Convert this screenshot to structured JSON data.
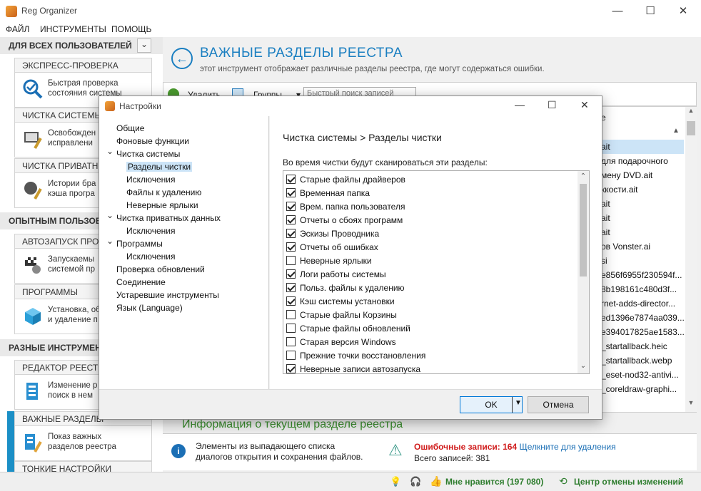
{
  "window": {
    "title": "Reg Organizer",
    "minimize": "—",
    "maximize": "☐",
    "close": "✕"
  },
  "menu": [
    "ФАЙЛ",
    "ИНСТРУМЕНТЫ",
    "ПОМОЩЬ"
  ],
  "sidebar": {
    "for_all_users": "ДЛЯ ВСЕХ ПОЛЬЗОВАТЕЛЕЙ",
    "experienced": "ОПЫТНЫМ ПОЛЬЗОВ",
    "various_tools": "РАЗНЫЕ ИНСТРУМЕНТ",
    "cards": [
      {
        "title": "ЭКСПРЕСС-ПРОВЕРКА",
        "l1": "Быстрая проверка",
        "l2": "состояния системы"
      },
      {
        "title": "ЧИСТКА СИСТЕМЫ",
        "l1": "Освобожден",
        "l2": "исправлени"
      },
      {
        "title": "ЧИСТКА ПРИВАТНЫ",
        "l1": "Истории бра",
        "l2": "кэша програ"
      },
      {
        "title": "АВТОЗАПУСК ПРОГ",
        "l1": "Запускаемы",
        "l2": "системой пр"
      },
      {
        "title": "ПРОГРАММЫ",
        "l1": "Установка, об",
        "l2": "и удаление п"
      },
      {
        "title": "РЕДАКТОР РЕЕСТРА",
        "l1": "Изменение р",
        "l2": "поиск в нем"
      },
      {
        "title": "ВАЖНЫЕ РАЗДЕЛЫ",
        "l1": "Показ важных",
        "l2": "разделов реестра"
      },
      {
        "title": "ТОНКИЕ НАСТРОЙКИ"
      }
    ]
  },
  "main": {
    "title": "ВАЖНЫЕ РАЗДЕЛЫ РЕЕСТРА",
    "subtitle": "этот инструмент отображает различные разделы реестра, где могут содержаться ошибки.",
    "toolbar": {
      "delete": "Удалить",
      "groups": "Группы",
      "search_placeholder": "Быстрый поиск записей"
    },
    "list_header": "е",
    "list_rows": [
      "ait",
      "для подарочного",
      "мену DVD.ait",
      "ккости.ait",
      "ait",
      "ait",
      "ait",
      "ов Vonster.ai",
      "si",
      "e856f6955f230594f...",
      "8b198161c480d3f...",
      "rnet-adds-director...",
      "ed1396e7874aa039...",
      "e394017825ae1583...",
      "_startallback.heic",
      "_startallback.webp",
      "_eset-nod32-antivi...",
      "_coreldraw-graphi..."
    ],
    "info_title": "Информация о текущем разделе реестра",
    "info_text1": "Элементы из выпадающего списка",
    "info_text2": "диалогов открытия и сохранения файлов.",
    "error_label": "Ошибочные записи:",
    "error_count": "164",
    "delete_link": "Щелкните для удаления",
    "total_label": "Всего записей:",
    "total_count": "381"
  },
  "status": {
    "like": "Мне нравится (197 080)",
    "undo": "Центр отмены изменений"
  },
  "dialog": {
    "title": "Настройки",
    "tree": [
      {
        "label": "Общие",
        "level": 0
      },
      {
        "label": "Фоновые функции",
        "level": 0
      },
      {
        "label": "Чистка системы",
        "level": 0,
        "expander": "⌄"
      },
      {
        "label": "Разделы чистки",
        "level": 1,
        "selected": true
      },
      {
        "label": "Исключения",
        "level": 1
      },
      {
        "label": "Файлы к удалению",
        "level": 1
      },
      {
        "label": "Неверные ярлыки",
        "level": 1
      },
      {
        "label": "Чистка приватных данных",
        "level": 0,
        "expander": "⌄"
      },
      {
        "label": "Исключения",
        "level": 1
      },
      {
        "label": "Программы",
        "level": 0,
        "expander": "⌄"
      },
      {
        "label": "Исключения",
        "level": 1
      },
      {
        "label": "Проверка обновлений",
        "level": 0
      },
      {
        "label": "Соединение",
        "level": 0
      },
      {
        "label": "Устаревшие инструменты",
        "level": 0
      },
      {
        "label": "Язык (Language)",
        "level": 0
      }
    ],
    "breadcrumb": "Чистка системы > Разделы чистки",
    "caption": "Во время чистки будут сканироваться эти разделы:",
    "items": [
      {
        "label": "Старые файлы драйверов",
        "checked": true
      },
      {
        "label": "Временная папка",
        "checked": true
      },
      {
        "label": "Врем. папка пользователя",
        "checked": true
      },
      {
        "label": "Отчеты о сбоях программ",
        "checked": true
      },
      {
        "label": "Эскизы Проводника",
        "checked": true
      },
      {
        "label": "Отчеты об ошибках",
        "checked": true
      },
      {
        "label": "Неверные ярлыки",
        "checked": false
      },
      {
        "label": "Логи работы системы",
        "checked": true
      },
      {
        "label": "Польз. файлы к удалению",
        "checked": true
      },
      {
        "label": "Кэш системы установки",
        "checked": true
      },
      {
        "label": "Старые файлы Корзины",
        "checked": false
      },
      {
        "label": "Старые файлы обновлений",
        "checked": false
      },
      {
        "label": "Старая версия Windows",
        "checked": false
      },
      {
        "label": "Прежние точки восстановления",
        "checked": false
      },
      {
        "label": "Неверные записи автозапуска",
        "checked": true
      }
    ],
    "ok": "OK",
    "cancel": "Отмена"
  }
}
